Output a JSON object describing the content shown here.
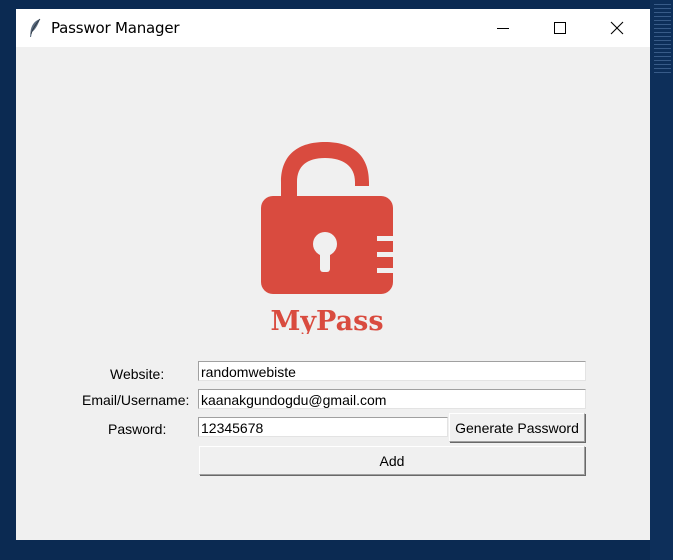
{
  "window": {
    "title": "Passwor Manager",
    "controls": {
      "minimize": "minimize-icon",
      "maximize": "maximize-icon",
      "close": "close-icon"
    }
  },
  "logo": {
    "text": "MyPass",
    "icon": "open-padlock-icon",
    "color": "#d94b3f"
  },
  "form": {
    "website_label": "Website:",
    "website_value": "randomwebiste",
    "email_label": "Email/Username:",
    "email_value": "kaanakgundogdu@gmail.com",
    "password_label": "Pasword:",
    "password_value": "12345678",
    "generate_label": "Generate Password",
    "add_label": "Add"
  }
}
